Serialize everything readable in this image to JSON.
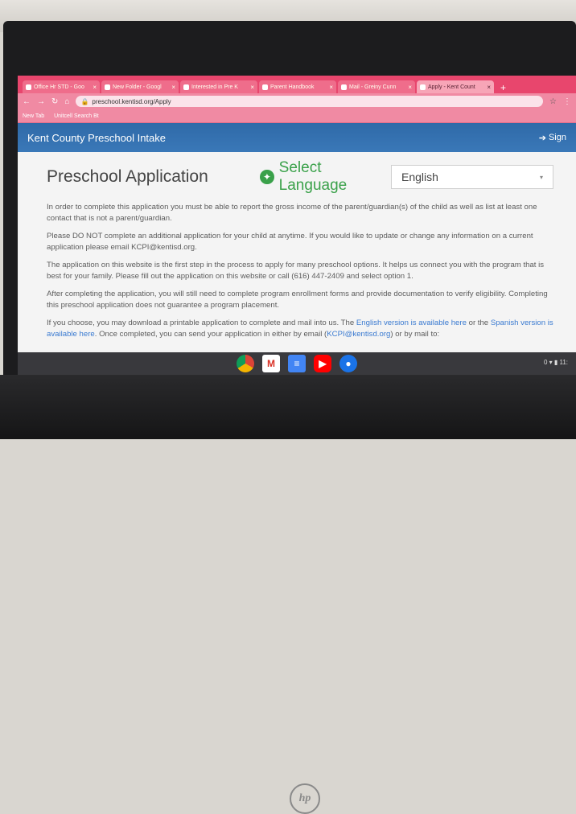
{
  "browser": {
    "tabs": [
      {
        "label": "Office Hr STD - Goo"
      },
      {
        "label": "New Folder - Googl"
      },
      {
        "label": "Interested in Pre K"
      },
      {
        "label": "Parent Handbook"
      },
      {
        "label": "Mail - Greiny Cunn"
      },
      {
        "label": "Apply - Kent Count",
        "active": true
      }
    ],
    "url": "preschool.kentisd.org/Apply",
    "bookmarks": [
      "New Tab",
      "Unitcell Search Bt"
    ]
  },
  "app": {
    "title": "Kent County Preschool Intake",
    "sign_in": "Sign"
  },
  "page": {
    "title": "Preschool Application",
    "select_language": "Select Language",
    "language_value": "English",
    "paragraphs": [
      "In order to complete this application you must be able to report the gross income of the parent/guardian(s) of the child as well as list at least one contact that is not a parent/guardian.",
      "Please DO NOT complete an additional application for your child at anytime. If you would like to update or change any information on a current application please email KCPI@kentisd.org.",
      "The application on this website is the first step in the process to apply for many preschool options. It helps us connect you with the program that is best for your family. Please fill out the application on this website or call (616) 447-2409 and select option 1.",
      "After completing the application, you will still need to complete program enrollment forms and provide documentation to verify eligibility. Completing this preschool application does not guarantee a program placement."
    ],
    "p5": {
      "before": "If you choose, you may download a printable application to complete and mail into us. The ",
      "link1": "English version is available here",
      "mid1": " or the ",
      "link2": "Spanish version is available here",
      "mid2": ". Once completed, you can send your application in either by email (",
      "email": "KCPI@kentisd.org",
      "after": ") or by mail to:"
    }
  },
  "shelf": {
    "apps": [
      "chrome-icon",
      "gmail-icon",
      "docs-icon",
      "youtube-icon",
      "files-icon"
    ],
    "tray": "0 ▾ ▮ 11:"
  },
  "colors": {
    "tabbar": "#e8466d",
    "header": "#3a78b8",
    "language_green": "#3aa14a",
    "link": "#3b7bd1"
  }
}
